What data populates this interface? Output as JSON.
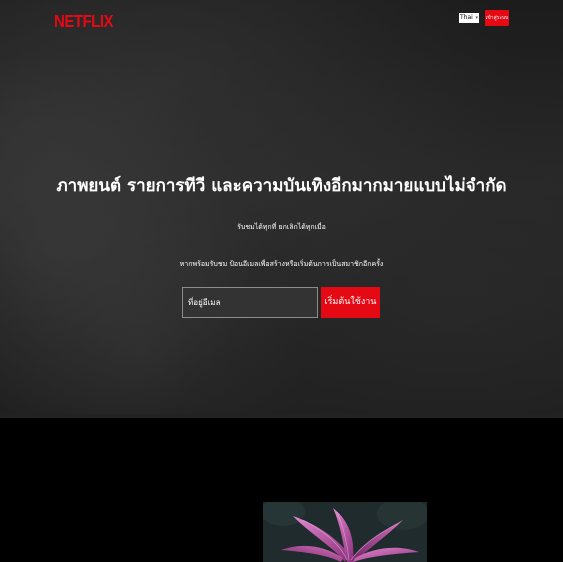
{
  "header": {
    "logo_text": "NETFLIX",
    "language_select_value": "Thai",
    "signin_label": "เข้าสู่ระบบ"
  },
  "hero": {
    "headline": "ภาพยนต์ รายการทีวี และความบันเทิงอีกมากมายแบบไม่จำกัด",
    "subline": "รับชมได้ทุกที่ ยกเลิกได้ทุกเมื่อ",
    "prompt": "หากพร้อมรับชม ป้อนอีเมลเพื่อสร้างหรือเริ่มต้นการเป็นสมาชิกอีกครั้ง",
    "email_placeholder": "ที่อยู่อีเมล",
    "start_button_label": "เริ่มต้นใช้งาน"
  },
  "colors": {
    "brand_red": "#e50914",
    "hero_background": "#232323",
    "page_background": "#000000",
    "plant_pink": "#c0569c"
  },
  "icons": {
    "language_chevron": "chevron-down-icon"
  }
}
